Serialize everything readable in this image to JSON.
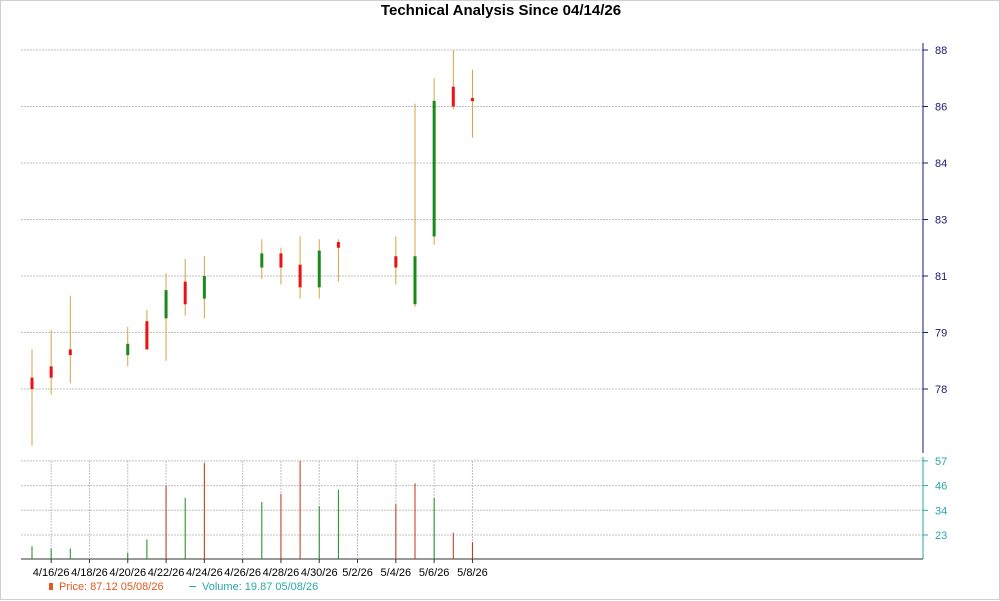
{
  "chart_data": [
    {
      "type": "candlestick",
      "title": "Technical Analysis Since 04/14/26",
      "xlabel": "",
      "ylabel": "",
      "date_range": [
        "4/14/26",
        "5/9/26"
      ],
      "yticks": [
        "78",
        "79",
        "81",
        "83",
        "84",
        "86",
        "88"
      ],
      "ylim": [
        76.9,
        88.1
      ],
      "xticks": [
        "4/16/26",
        "4/18/26",
        "4/20/26",
        "4/22/26",
        "4/24/26",
        "4/26/26",
        "4/28/26",
        "4/30/26",
        "5/2/26",
        "5/4/26",
        "5/6/26",
        "5/8/26"
      ],
      "colors": {
        "up": "#1a8a1a",
        "down": "#ee1111",
        "wick": "#d9a046",
        "grid": "#c0c0c0",
        "axis": "#1a1a6e"
      },
      "candles": [
        {
          "date": "4/15/26",
          "open": 78.2,
          "high": 78.7,
          "low": 77.0,
          "close": 78.0
        },
        {
          "date": "4/16/26",
          "open": 78.4,
          "high": 79.1,
          "low": 77.9,
          "close": 78.2
        },
        {
          "date": "4/17/26",
          "open": 78.7,
          "high": 80.3,
          "low": 78.1,
          "close": 78.6
        },
        {
          "date": "4/20/26",
          "open": 78.6,
          "high": 79.2,
          "low": 78.4,
          "close": 78.8
        },
        {
          "date": "4/21/26",
          "open": 79.4,
          "high": 79.8,
          "low": 78.7,
          "close": 78.7
        },
        {
          "date": "4/22/26",
          "open": 79.5,
          "high": 81.1,
          "low": 78.5,
          "close": 80.5
        },
        {
          "date": "4/23/26",
          "open": 80.8,
          "high": 81.6,
          "low": 79.6,
          "close": 80.0
        },
        {
          "date": "4/24/26",
          "open": 80.2,
          "high": 81.7,
          "low": 79.5,
          "close": 81.0
        },
        {
          "date": "4/27/26",
          "open": 81.3,
          "high": 82.3,
          "low": 80.9,
          "close": 81.8
        },
        {
          "date": "4/28/26",
          "open": 81.8,
          "high": 82.0,
          "low": 80.7,
          "close": 81.3
        },
        {
          "date": "4/29/26",
          "open": 81.4,
          "high": 82.4,
          "low": 80.2,
          "close": 80.6
        },
        {
          "date": "4/30/26",
          "open": 80.6,
          "high": 82.3,
          "low": 80.2,
          "close": 81.9
        },
        {
          "date": "5/1/26",
          "open": 82.2,
          "high": 82.3,
          "low": 80.8,
          "close": 82.0
        },
        {
          "date": "5/4/26",
          "open": 81.7,
          "high": 82.4,
          "low": 80.7,
          "close": 81.3
        },
        {
          "date": "5/5/26",
          "open": 80.0,
          "high": 86.1,
          "low": 79.9,
          "close": 81.7
        },
        {
          "date": "5/6/26",
          "open": 82.4,
          "high": 87.0,
          "low": 82.1,
          "close": 86.2
        },
        {
          "date": "5/7/26",
          "open": 86.7,
          "high": 88.0,
          "low": 85.9,
          "close": 86.0
        },
        {
          "date": "5/8/26",
          "open": 86.3,
          "high": 87.3,
          "low": 84.9,
          "close": 86.2
        }
      ]
    },
    {
      "type": "bar",
      "title": "",
      "yticks": [
        "23",
        "34",
        "46",
        "57"
      ],
      "ylim": [
        16,
        57
      ],
      "colors": {
        "up": "#1a8a1a",
        "down": "#c43314"
      },
      "series": [
        {
          "dates": [
            "4/15/26",
            "4/16/26",
            "4/17/26",
            "4/20/26",
            "4/21/26",
            "4/22/26",
            "4/23/26",
            "4/24/26",
            "4/27/26",
            "4/28/26",
            "4/29/26",
            "4/30/26",
            "5/1/26",
            "5/4/26",
            "5/5/26",
            "5/6/26",
            "5/7/26",
            "5/8/26"
          ],
          "values": [
            18.0,
            17.0,
            17.0,
            15.0,
            21.0,
            46.0,
            40.0,
            56.0,
            38.0,
            42.0,
            57.0,
            36.0,
            44.0,
            37.0,
            47.0,
            40.0,
            24.0,
            19.87
          ],
          "direction": [
            "up",
            "up",
            "up",
            "up",
            "up",
            "down",
            "up",
            "down",
            "up",
            "down",
            "down",
            "up",
            "up",
            "down",
            "down",
            "up",
            "down",
            "down"
          ]
        }
      ]
    }
  ],
  "legend": {
    "price_text": "Price: 87.12  05/08/26",
    "volume_text": "Volume: 19.87  05/08/26"
  }
}
